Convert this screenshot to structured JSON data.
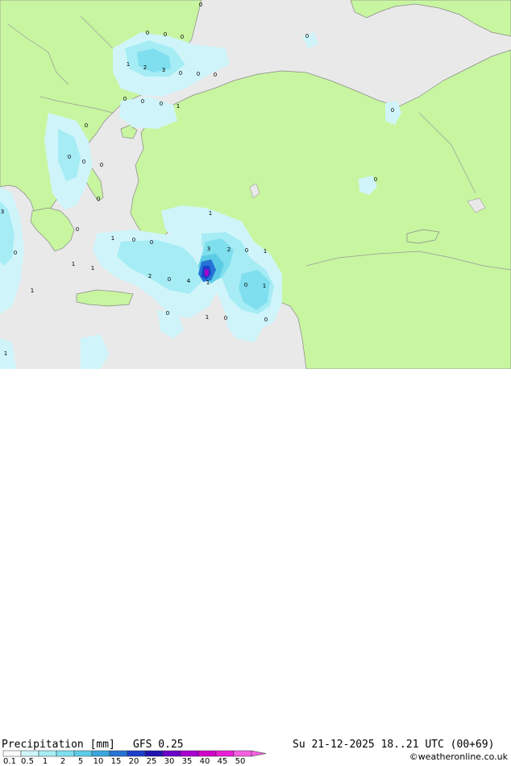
{
  "footer": {
    "title": "Precipitation [mm]",
    "model": "GFS 0.25",
    "valid_time": "Su 21-12-2025 18..21 UTC (00+69)",
    "credit": "©weatheronline.co.uk"
  },
  "legend": {
    "ticks": [
      "0.1",
      "0.5",
      "1",
      "2",
      "5",
      "10",
      "15",
      "20",
      "25",
      "30",
      "35",
      "40",
      "45",
      "50"
    ],
    "colors": [
      "#ffffff",
      "#cff5fa",
      "#a6ecf5",
      "#7fdfee",
      "#5ccbe6",
      "#3aa6dc",
      "#2673d6",
      "#1a3fc9",
      "#2014b0",
      "#6a00c8",
      "#a800d0",
      "#d100c8",
      "#e81fd6",
      "#f560e0"
    ]
  },
  "colors": {
    "land": "#c8f5a0",
    "sea": "#e9e9e9",
    "border": "#9a9a9a",
    "coast": "#888888"
  },
  "map_values": [
    "0",
    "0",
    "0",
    "0",
    "1",
    "2",
    "3",
    "0",
    "0",
    "0",
    "0",
    "0",
    "0",
    "1",
    "0",
    "0",
    "0",
    "0",
    "0",
    "0",
    "0",
    "0",
    "3",
    "0",
    "1",
    "0",
    "1",
    "0",
    "0",
    "1",
    "1",
    "2",
    "0",
    "1",
    "3",
    "2",
    "0",
    "4",
    "1",
    "0",
    "1",
    "1",
    "0",
    "1",
    "0",
    "0",
    "1"
  ]
}
